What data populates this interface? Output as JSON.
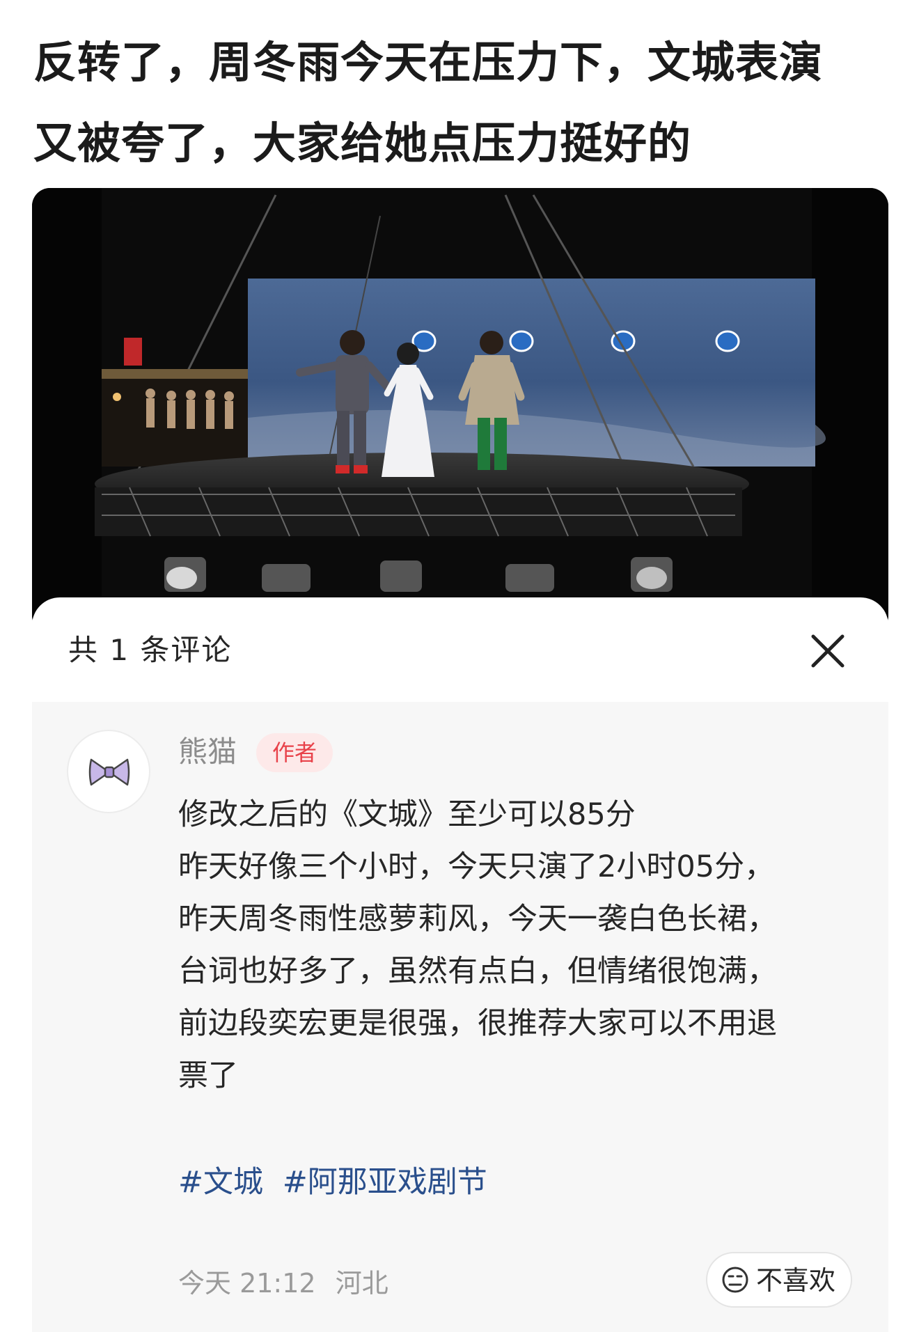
{
  "headline": {
    "line1": "反转了，周冬雨今天在压力下，文城表演",
    "line2": "又被夸了，大家给她点压力挺好的"
  },
  "photo": {
    "icon": "stage-photo"
  },
  "comments_panel": {
    "title": "共 1 条评论",
    "close_icon": "close-icon"
  },
  "comment": {
    "username": "熊猫",
    "badge": "作者",
    "avatar_icon": "bow-icon",
    "lines": [
      "修改之后的《文城》至少可以85分",
      "昨天好像三个小时，今天只演了2小时05分，",
      "昨天周冬雨性感萝莉风，今天一袭白色长裙，",
      "台词也好多了，虽然有点白，但情绪很饱满，",
      "前边段奕宏更是很强，很推荐大家可以不用退",
      "票了"
    ],
    "hashtags": [
      "#文城",
      "#阿那亚戏剧节"
    ],
    "time": "今天 21:12",
    "location": "河北",
    "dislike_label": "不喜欢"
  },
  "colors": {
    "badge_text": "#e8424a",
    "badge_bg": "#fde9e9",
    "hashtag": "#2a4f8c",
    "meta": "#9a9a9a"
  }
}
